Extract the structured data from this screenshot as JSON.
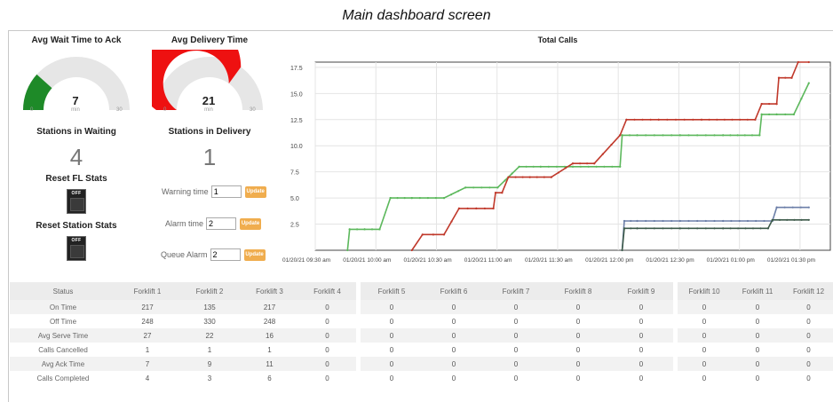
{
  "caption": "Main dashboard screen",
  "gauges": [
    {
      "title": "Avg Wait Time to Ack",
      "value": "7",
      "unit": "min",
      "min": "0",
      "max": "30",
      "fraction": 0.2333,
      "color": "#1e8a28"
    },
    {
      "title": "Avg Delivery Time",
      "value": "21",
      "unit": "min",
      "min": "0",
      "max": "30",
      "fraction": 0.7,
      "color": "#ee1111"
    }
  ],
  "stations": [
    {
      "title": "Stations in Waiting",
      "count": "4"
    },
    {
      "title": "Stations in Delivery",
      "count": "1"
    }
  ],
  "resets": [
    {
      "title": "Reset FL Stats",
      "toggle": "OFF"
    },
    {
      "title": "Reset Station Stats",
      "toggle": "OFF"
    }
  ],
  "settings": [
    {
      "label": "Warning time",
      "value": "1",
      "button": "Update"
    },
    {
      "label": "Alarm time",
      "value": "2",
      "button": "Update"
    },
    {
      "label": "Queue Alarm",
      "value": "2",
      "button": "Update"
    }
  ],
  "chart_data": {
    "type": "line",
    "title": "Total Calls",
    "xlabel": "",
    "ylabel": "",
    "ylim": [
      0,
      18
    ],
    "xlim": [
      "01/20/21 09:30 am",
      "01/20/21 01:30 pm"
    ],
    "yticks": [
      "2.5",
      "5.0",
      "7.5",
      "10.0",
      "12.5",
      "15.0",
      "17.5"
    ],
    "xticks": [
      "01/20/21 09:30 am",
      "01/20/21 10:00 am",
      "01/20/21 10:30 am",
      "01/20/21 11:00 am",
      "01/20/21 11:30 am",
      "01/20/21 12:00 pm",
      "01/20/21 12:30 pm",
      "01/20/21 01:00 pm",
      "01/20/21 01:30 pm"
    ],
    "series": [
      {
        "color": "#5cb85c",
        "points": [
          [
            "09:45",
            0
          ],
          [
            "09:46",
            2
          ],
          [
            "09:53",
            2
          ],
          [
            "10:00",
            2
          ],
          [
            "10:05",
            5
          ],
          [
            "10:15",
            5
          ],
          [
            "10:30",
            5
          ],
          [
            "10:40",
            6
          ],
          [
            "10:55",
            6
          ],
          [
            "11:05",
            8
          ],
          [
            "11:15",
            8
          ],
          [
            "11:30",
            8
          ],
          [
            "11:52",
            8
          ],
          [
            "11:53",
            11
          ],
          [
            "12:00",
            11
          ],
          [
            "12:20",
            11
          ],
          [
            "12:40",
            11
          ],
          [
            "12:57",
            11
          ],
          [
            "12:58",
            13
          ],
          [
            "13:05",
            13
          ],
          [
            "13:13",
            13
          ],
          [
            "13:20",
            16
          ]
        ]
      },
      {
        "color": "#c0392b",
        "points": [
          [
            "10:15",
            0
          ],
          [
            "10:20",
            1.5
          ],
          [
            "10:25",
            1.5
          ],
          [
            "10:30",
            1.5
          ],
          [
            "10:37",
            4
          ],
          [
            "10:45",
            4
          ],
          [
            "10:53",
            4
          ],
          [
            "10:54",
            5.5
          ],
          [
            "10:57",
            5.5
          ],
          [
            "11:00",
            7
          ],
          [
            "11:10",
            7
          ],
          [
            "11:20",
            7
          ],
          [
            "11:30",
            8.3
          ],
          [
            "11:40",
            8.3
          ],
          [
            "11:52",
            11
          ],
          [
            "11:55",
            12.5
          ],
          [
            "12:10",
            12.5
          ],
          [
            "12:30",
            12.5
          ],
          [
            "12:55",
            12.5
          ],
          [
            "12:58",
            14
          ],
          [
            "13:05",
            14
          ],
          [
            "13:06",
            16.5
          ],
          [
            "13:12",
            16.5
          ],
          [
            "13:15",
            18
          ],
          [
            "13:20",
            18
          ]
        ]
      },
      {
        "color": "#6c7fa8",
        "points": [
          [
            "11:53",
            0
          ],
          [
            "11:54",
            2.8
          ],
          [
            "12:00",
            2.8
          ],
          [
            "12:20",
            2.8
          ],
          [
            "12:40",
            2.8
          ],
          [
            "13:03",
            2.8
          ],
          [
            "13:05",
            4.1
          ],
          [
            "13:20",
            4.1
          ]
        ]
      },
      {
        "color": "#3d5a4a",
        "points": [
          [
            "11:53",
            0
          ],
          [
            "11:54",
            2.1
          ],
          [
            "12:00",
            2.1
          ],
          [
            "12:20",
            2.1
          ],
          [
            "12:40",
            2.1
          ],
          [
            "13:01",
            2.1
          ],
          [
            "13:03",
            2.9
          ],
          [
            "13:20",
            2.9
          ]
        ]
      }
    ]
  },
  "tables": [
    {
      "headers": [
        "Status",
        "Forklift 1",
        "Forklift 2",
        "Forklift 3",
        "Forklift 4"
      ],
      "rows": [
        [
          "On Time",
          "217",
          "135",
          "217",
          "0"
        ],
        [
          "Off Time",
          "248",
          "330",
          "248",
          "0"
        ],
        [
          "Avg Serve Time",
          "27",
          "22",
          "16",
          "0"
        ],
        [
          "Calls Cancelled",
          "1",
          "1",
          "1",
          "0"
        ],
        [
          "Avg Ack Time",
          "7",
          "9",
          "11",
          "0"
        ],
        [
          "Calls Completed",
          "4",
          "3",
          "6",
          "0"
        ]
      ]
    },
    {
      "headers": [
        "Forklift 5",
        "Forklift 6",
        "Forklift 7",
        "Forklift 8",
        "Forklift 9"
      ],
      "rows": [
        [
          "0",
          "0",
          "0",
          "0",
          "0"
        ],
        [
          "0",
          "0",
          "0",
          "0",
          "0"
        ],
        [
          "0",
          "0",
          "0",
          "0",
          "0"
        ],
        [
          "0",
          "0",
          "0",
          "0",
          "0"
        ],
        [
          "0",
          "0",
          "0",
          "0",
          "0"
        ],
        [
          "0",
          "0",
          "0",
          "0",
          "0"
        ]
      ]
    },
    {
      "headers": [
        "Forklift 10",
        "Forklift 11",
        "Forklift 12"
      ],
      "rows": [
        [
          "0",
          "0",
          "0"
        ],
        [
          "0",
          "0",
          "0"
        ],
        [
          "0",
          "0",
          "0"
        ],
        [
          "0",
          "0",
          "0"
        ],
        [
          "0",
          "0",
          "0"
        ],
        [
          "0",
          "0",
          "0"
        ]
      ]
    }
  ]
}
